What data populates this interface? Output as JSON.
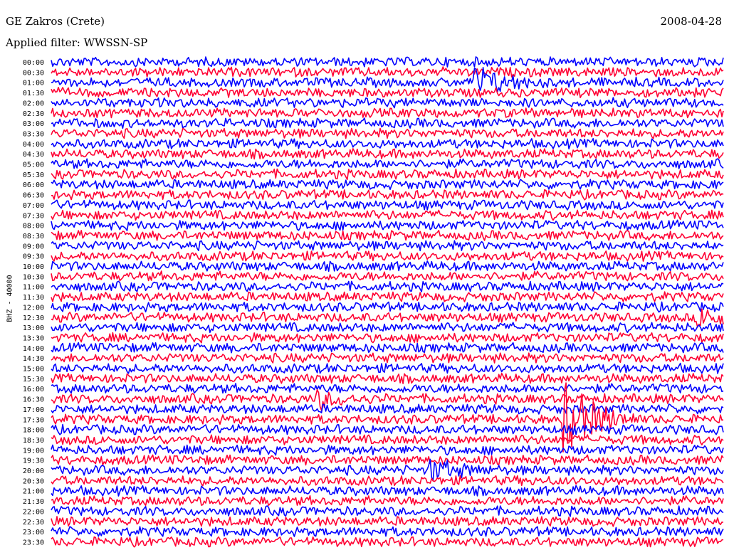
{
  "header": {
    "station": "GE Zakros (Crete)",
    "date": "2008-04-28",
    "filter": "Applied filter: WWSSN-SP"
  },
  "chart_data": {
    "type": "line",
    "title": "GE Zakros (Crete)",
    "subtitle": "Applied filter: WWSSN-SP",
    "ylabel": "BHZ - 40000",
    "rows": [
      "00:00",
      "00:30",
      "01:00",
      "01:30",
      "02:00",
      "02:30",
      "03:00",
      "03:30",
      "04:00",
      "04:30",
      "05:00",
      "05:30",
      "06:00",
      "06:30",
      "07:00",
      "07:30",
      "08:00",
      "08:30",
      "09:00",
      "09:30",
      "10:00",
      "10:30",
      "11:00",
      "11:30",
      "12:00",
      "12:30",
      "13:00",
      "13:30",
      "14:00",
      "14:30",
      "15:00",
      "15:30",
      "16:00",
      "16:30",
      "17:00",
      "17:30",
      "18:00",
      "18:30",
      "19:00",
      "19:30",
      "20:00",
      "20:30",
      "21:00",
      "21:30",
      "22:00",
      "22:30",
      "23:00",
      "23:30"
    ],
    "row_minutes": 30,
    "trace_colors": [
      "#0000ff",
      "#ff0033"
    ],
    "grid": false,
    "legend": "none",
    "events": [
      {
        "row": "01:00",
        "minute": 19,
        "amplitude": 4
      },
      {
        "row": "12:30",
        "minute": 29,
        "amplitude": 3
      },
      {
        "row": "16:30",
        "minute": 12,
        "amplitude": 2.5
      },
      {
        "row": "17:30",
        "minute": 23,
        "amplitude": 9
      },
      {
        "row": "20:00",
        "minute": 17,
        "amplitude": 3
      }
    ]
  }
}
